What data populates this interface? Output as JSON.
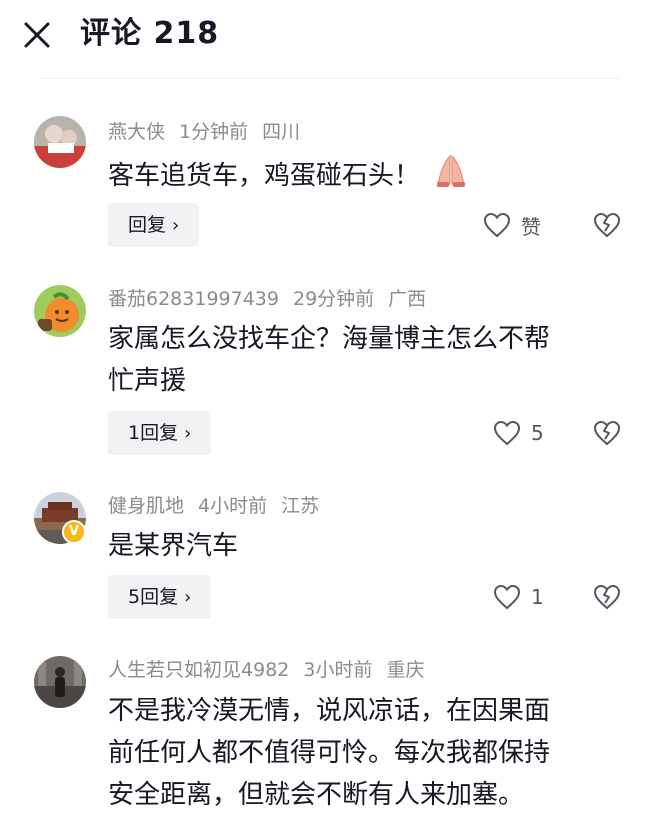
{
  "header": {
    "title": "评论 218"
  },
  "comments": [
    {
      "username": "燕大侠",
      "time": "1分钟前",
      "location": "四川",
      "text": "客车追货车，鸡蛋碰石头！",
      "emoji": "folded-hands",
      "reply_label": "回复",
      "like_label": "赞"
    },
    {
      "username": "番茄62831997439",
      "time": "29分钟前",
      "location": "广西",
      "text_line1": "家属怎么没找车企？海量博主怎么不帮",
      "text_line2": "忙声援",
      "reply_label": "1回复",
      "like_label": "5"
    },
    {
      "username": "健身肌地",
      "time": "4小时前",
      "location": "江苏",
      "text": "是某界汽车",
      "verified_badge": "V",
      "reply_label": "5回复",
      "like_label": "1"
    },
    {
      "username": "人生若只如初见4982",
      "time": "3小时前",
      "location": "重庆",
      "text_line1": "不是我冷漠无情，说风凉话，在因果面",
      "text_line2": "前任何人都不值得可怜。每次我都保持",
      "text_line3": "安全距离，但就会不断有人来加塞。"
    }
  ],
  "colors": {
    "text_primary": "#161823",
    "text_secondary": "#8a8b91",
    "reply_bg": "#f2f2f4",
    "verified": "#f5b91a"
  }
}
